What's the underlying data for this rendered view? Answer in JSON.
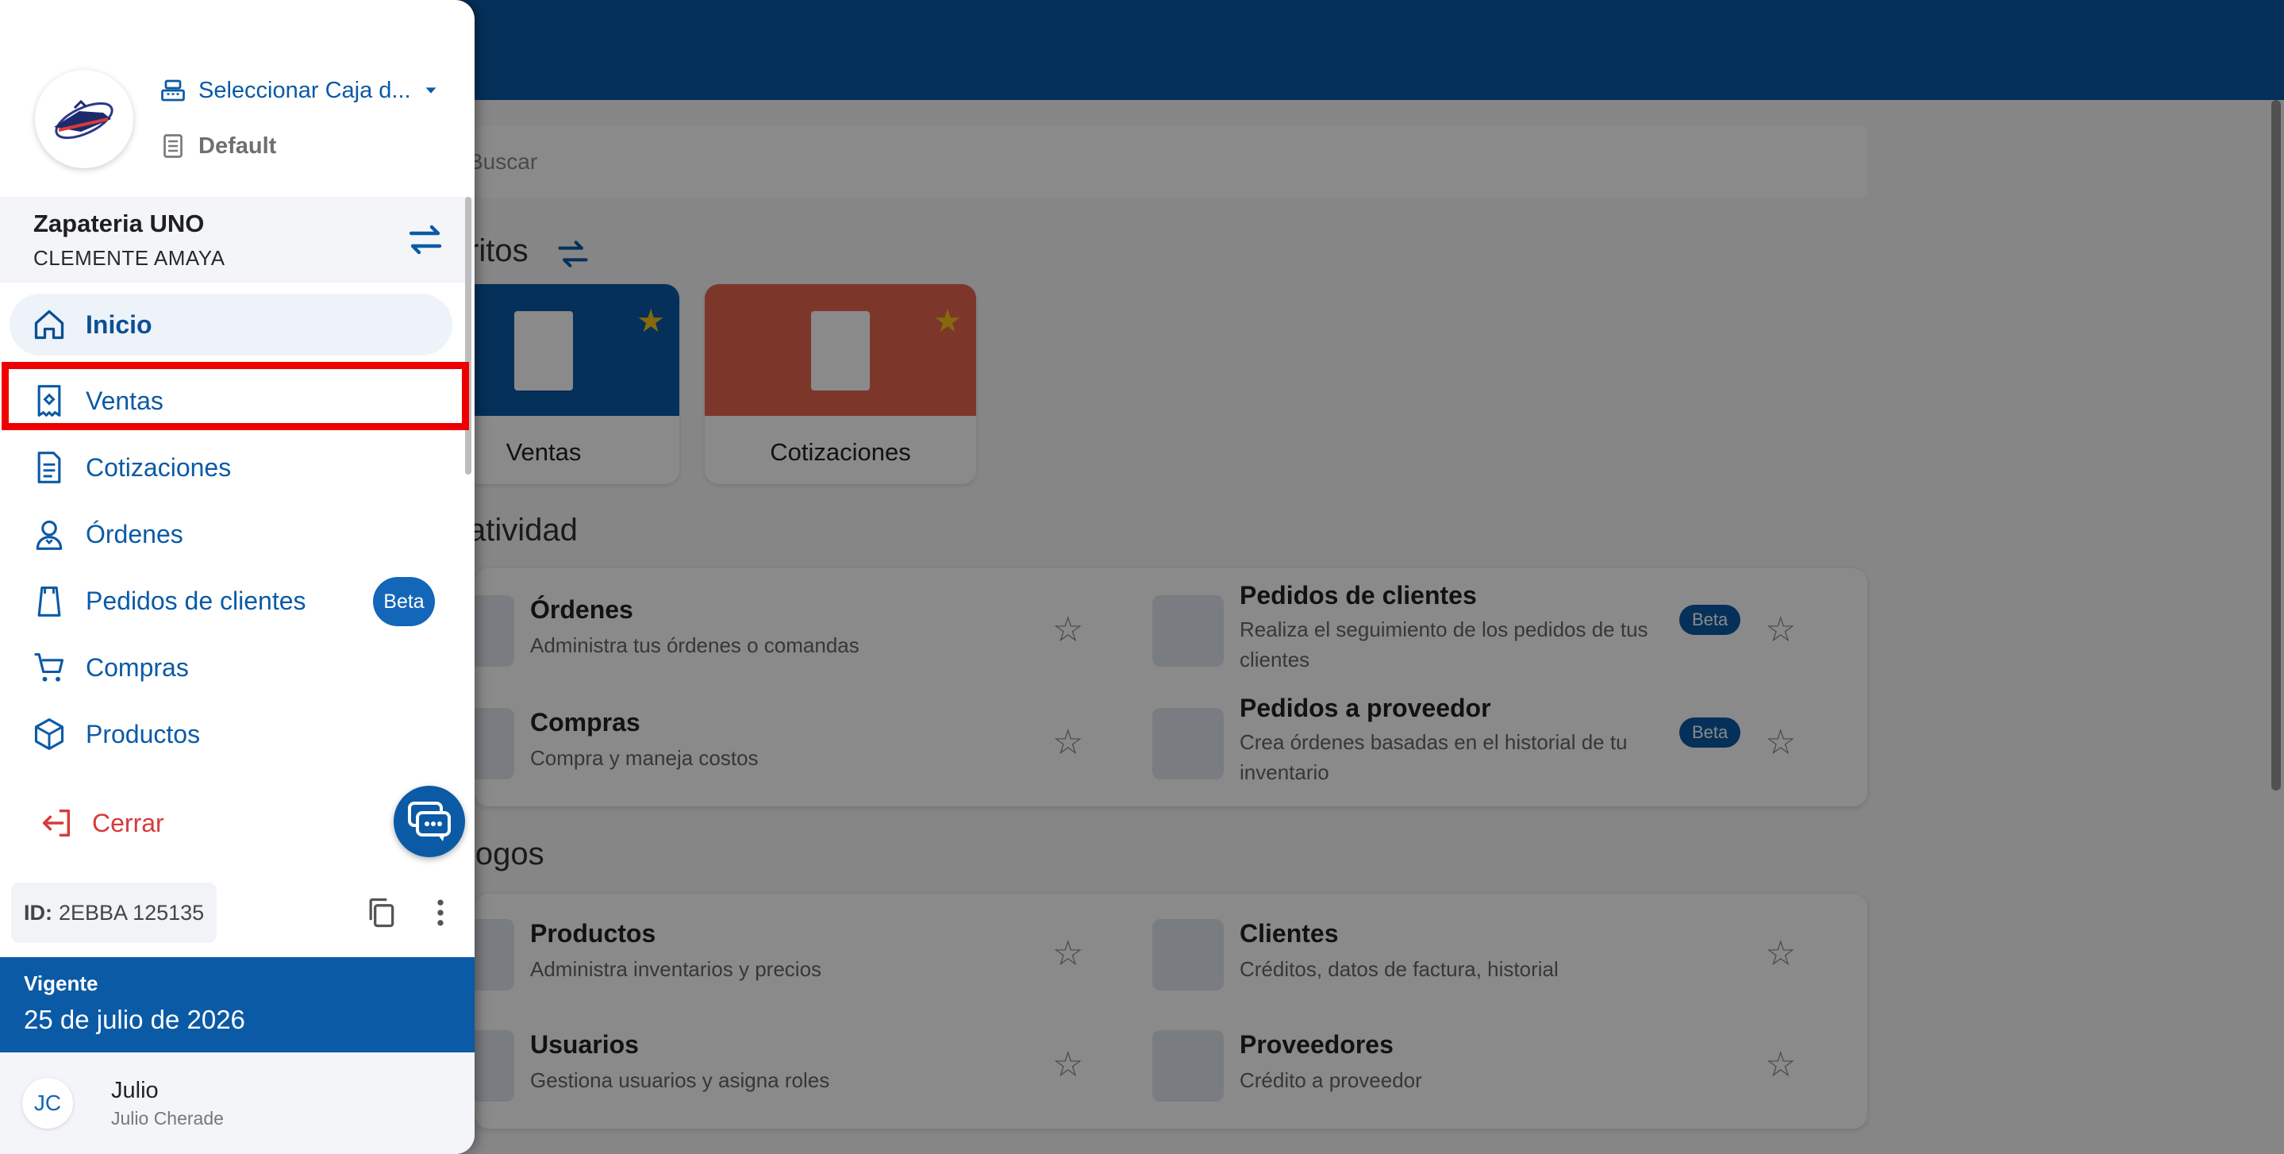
{
  "colors": {
    "brand": "#0b5aa6",
    "highlight": "#ee0000",
    "cerrar": "#d63a3a",
    "cotizaciones_card": "#e8664f"
  },
  "background": {
    "search_placeholder": "Buscar",
    "favoritos_title": "ritos",
    "favorites": [
      {
        "label": "Ventas"
      },
      {
        "label": "Cotizaciones"
      }
    ],
    "productividad_title": "atividad",
    "productividad": [
      {
        "title": "Órdenes",
        "subtitle": "Administra tus órdenes o comandas",
        "beta": ""
      },
      {
        "title": "Pedidos de clientes",
        "subtitle": "Realiza el seguimiento de los pedidos de tus clientes",
        "beta": "Beta"
      },
      {
        "title": "Compras",
        "subtitle": "Compra y maneja costos",
        "beta": ""
      },
      {
        "title": "Pedidos a proveedor",
        "subtitle": "Crea órdenes basadas en el historial de tu inventario",
        "beta": "Beta"
      }
    ],
    "catalogos_title": "logos",
    "catalogos": [
      {
        "title": "Productos",
        "subtitle": "Administra inventarios y precios"
      },
      {
        "title": "Clientes",
        "subtitle": "Créditos, datos de factura, historial"
      },
      {
        "title": "Usuarios",
        "subtitle": "Gestiona usuarios y asigna roles"
      },
      {
        "title": "Proveedores",
        "subtitle": "Crédito a proveedor"
      }
    ]
  },
  "drawer": {
    "caja_select": "Seleccionar Caja d...",
    "default_label": "Default",
    "company_name": "Zapateria UNO",
    "company_user": "CLEMENTE AMAYA",
    "nav": [
      {
        "label": "Inicio",
        "icon": "home-icon"
      },
      {
        "label": "Ventas",
        "icon": "receipt-icon"
      },
      {
        "label": "Cotizaciones",
        "icon": "document-icon"
      },
      {
        "label": "Órdenes",
        "icon": "waiter-icon"
      },
      {
        "label": "Pedidos de clientes",
        "icon": "bag-icon"
      },
      {
        "label": "Compras",
        "icon": "cart-icon"
      },
      {
        "label": "Productos",
        "icon": "box-icon"
      }
    ],
    "beta_badge": "Beta",
    "cerrar_label": "Cerrar",
    "id_prefix": "ID:",
    "id_value": "2EBBA 125135",
    "vigente_title": "Vigente",
    "vigente_date": "25 de julio de 2026",
    "user_initials": "JC",
    "user_name": "Julio",
    "user_fullname": "Julio Cherade"
  }
}
